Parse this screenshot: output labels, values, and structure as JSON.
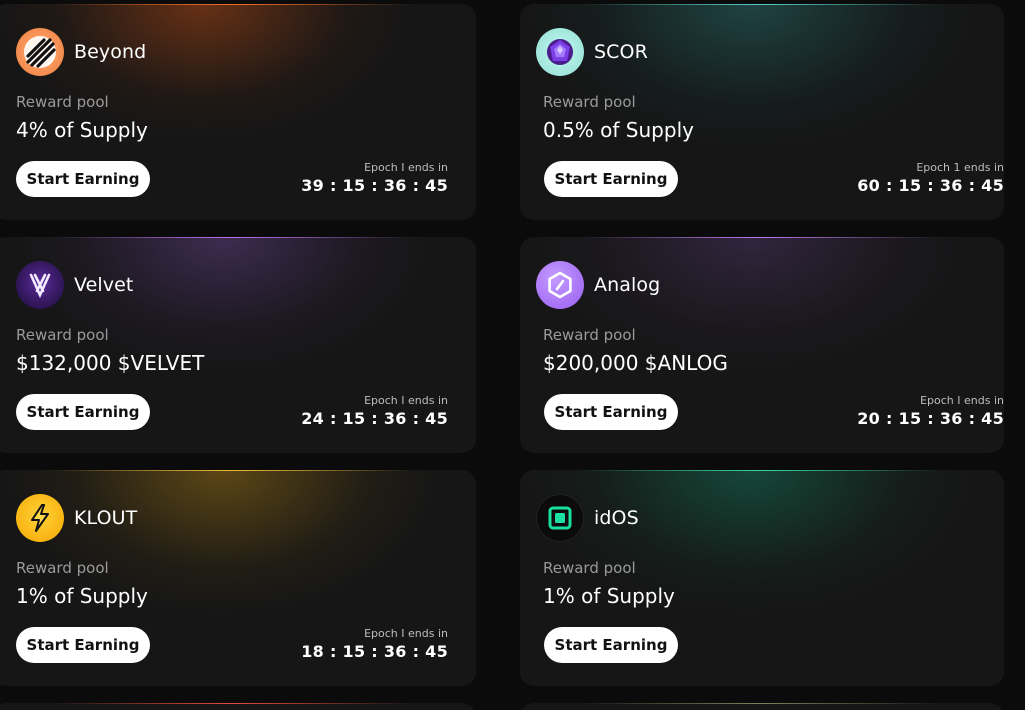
{
  "cards": [
    {
      "name": "Beyond",
      "logo_icon": "beyond-striped-sphere-icon",
      "reward_pool_label": "Reward pool",
      "reward_pool_value": "4% of Supply",
      "button_label": "Start Earning",
      "epoch_label": "Epoch I ends in",
      "countdown": "39 : 15 : 36 : 45",
      "accent": "#c2501e"
    },
    {
      "name": "SCOR",
      "logo_icon": "scor-purple-gem-icon",
      "reward_pool_label": "Reward pool",
      "reward_pool_value": "0.5% of Supply",
      "button_label": "Start Earning",
      "epoch_label": "Epoch 1 ends in",
      "countdown": "60 : 15 : 36 : 45",
      "accent": "#3e8a86"
    },
    {
      "name": "Velvet",
      "logo_icon": "velvet-v-icon",
      "reward_pool_label": "Reward pool",
      "reward_pool_value": "$132,000 $VELVET",
      "button_label": "Start Earning",
      "epoch_label": "Epoch I ends in",
      "countdown": "24 : 15 : 36 : 45",
      "accent": "#8a4fd0"
    },
    {
      "name": "Analog",
      "logo_icon": "analog-hexagon-icon",
      "reward_pool_label": "Reward pool",
      "reward_pool_value": "$200,000 $ANLOG",
      "button_label": "Start Earning",
      "epoch_label": "Epoch I ends in",
      "countdown": "20 : 15 : 36 : 45",
      "accent": "#a06ae8"
    },
    {
      "name": "KLOUT",
      "logo_icon": "klout-lightning-icon",
      "reward_pool_label": "Reward pool",
      "reward_pool_value": "1% of Supply",
      "button_label": "Start Earning",
      "epoch_label": "Epoch I ends in",
      "countdown": "18 : 15 : 36 : 45",
      "accent": "#c9a21a"
    },
    {
      "name": "idOS",
      "logo_icon": "idos-square-icon",
      "reward_pool_label": "Reward pool",
      "reward_pool_value": "1% of Supply",
      "button_label": "Start Earning",
      "epoch_label": "",
      "countdown": "",
      "accent": "#1fa37a"
    }
  ]
}
